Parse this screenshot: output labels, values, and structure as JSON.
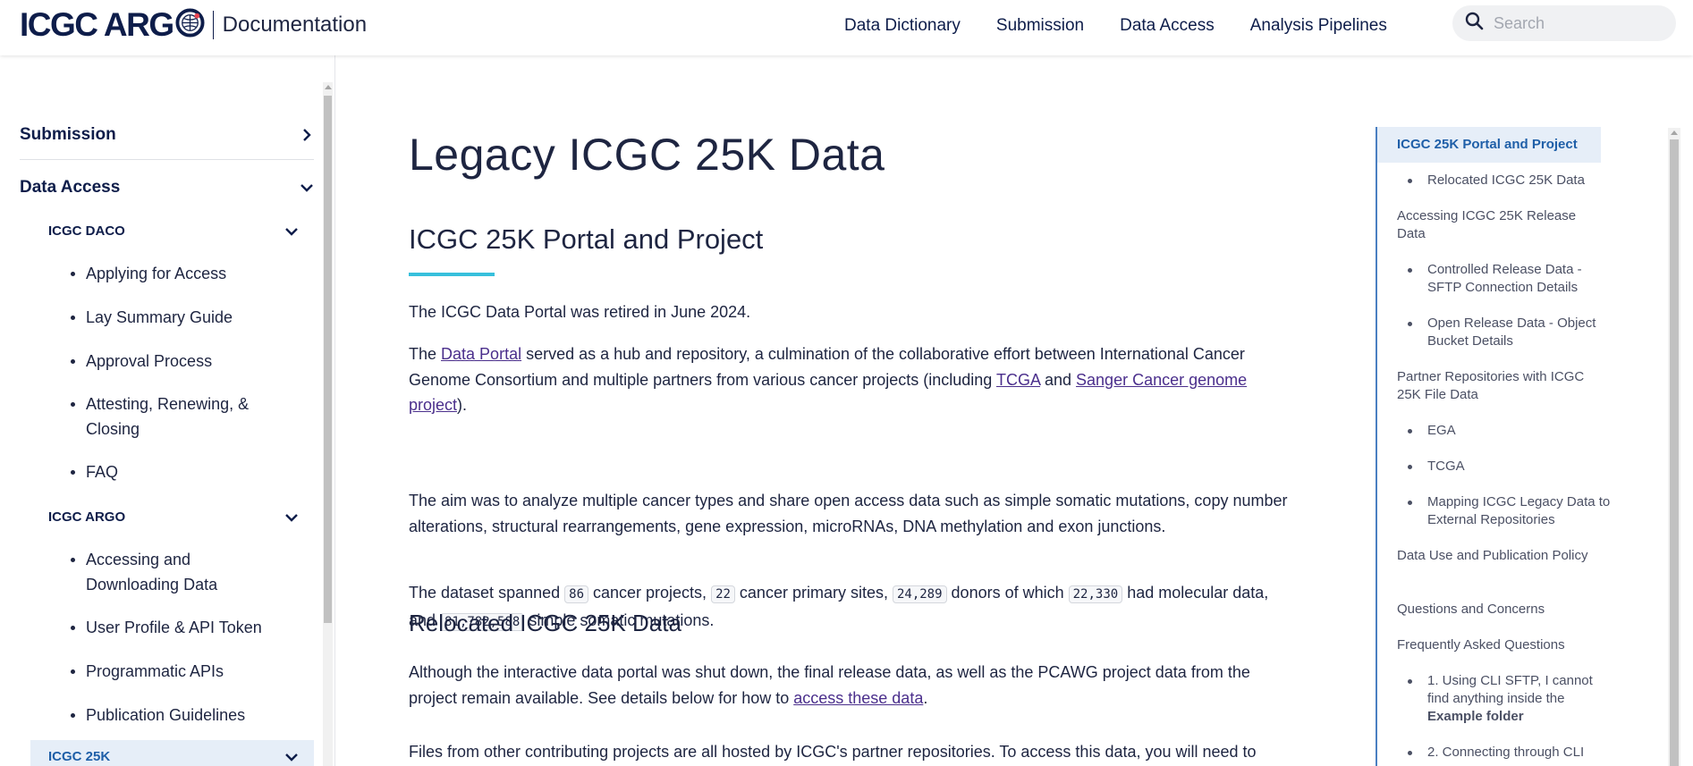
{
  "header": {
    "logo_text": "ICGC ARG",
    "subtitle": "Documentation",
    "nav": [
      "Data Dictionary",
      "Submission",
      "Data Access",
      "Analysis Pipelines"
    ],
    "search_placeholder": "Search"
  },
  "sidebar": {
    "top_items": [
      "Submission",
      "Data Access"
    ],
    "sections": [
      "ICGC DACO",
      "ICGC ARGO",
      "ICGC 25K"
    ],
    "daco_links": [
      "Applying for Access",
      "Lay Summary Guide",
      "Approval Process",
      "Attesting, Renewing, & Closing",
      "FAQ"
    ],
    "argo_links": [
      "Accessing and Downloading Data",
      "User Profile & API Token",
      "Programmatic APIs",
      "Publication Guidelines"
    ]
  },
  "main": {
    "title": "Legacy ICGC 25K Data",
    "section_title": "ICGC 25K Portal and Project",
    "p1": "The ICGC Data Portal was retired in June 2024.",
    "p2": {
      "a": "The ",
      "link1": "Data Portal",
      "b": " served as a hub and repository, a culmination of the collaborative effort between International Cancer Genome Consortium and multiple partners from various cancer projects (including ",
      "link2": "TCGA",
      "c": " and ",
      "link3": "Sanger Cancer genome project",
      "d": ")."
    },
    "p3": "The aim was to analyze multiple cancer types and share open access data such as simple somatic mutations, copy number alterations, structural rearrangements, gene expression, microRNAs, DNA methylation and exon junctions.",
    "p4": {
      "a": "The dataset spanned ",
      "n1": "86",
      "b": " cancer projects, ",
      "n2": "22",
      "c": " cancer primary sites, ",
      "n3": "24,289",
      "d": " donors of which ",
      "n4": "22,330",
      "e": " had molecular data, and ",
      "n5": "81,782,588",
      "f": " simple somatic mutations."
    },
    "subsection_title": "Relocated ICGC 25K Data",
    "p5": {
      "a": "Although the interactive data portal was shut down, the final release data, as well as the PCAWG project data from the project remain available. See details below for how to ",
      "link": "access these data",
      "b": "."
    },
    "p6": "Files from other contributing projects are all hosted by ICGC's partner repositories. To access this data, you will need to identify which repository hosts the data you are looking for and then request the data through their"
  },
  "toc": {
    "items": [
      {
        "level": 1,
        "text": "ICGC 25K Portal and Project",
        "current": true
      },
      {
        "level": 2,
        "text": "Relocated ICGC 25K Data"
      },
      {
        "level": 1,
        "text": "Accessing ICGC 25K Release Data"
      },
      {
        "level": 2,
        "text": "Controlled Release Data - SFTP Connection Details"
      },
      {
        "level": 2,
        "text": "Open Release Data - Object Bucket Details"
      },
      {
        "level": 1,
        "text": "Partner Repositories with ICGC 25K File Data"
      },
      {
        "level": 2,
        "text": "EGA"
      },
      {
        "level": 2,
        "text": "TCGA"
      },
      {
        "level": 2,
        "text": "Mapping ICGC Legacy Data to External Repositories"
      },
      {
        "level": 1,
        "text": "Data Use and Publication Policy"
      },
      {
        "level": 1,
        "text": "Questions and Concerns"
      },
      {
        "level": 1,
        "text": "Frequently Asked Questions"
      },
      {
        "level": 2,
        "text_a": "1. Using CLI SFTP, I cannot find anything inside the ",
        "text_b": "Example folder"
      },
      {
        "level": 2,
        "text": "2. Connecting through CLI"
      }
    ]
  },
  "colors": {
    "navy": "#0e1d4a",
    "accent_bar": "#37c0dc",
    "link": "#4b2f8c",
    "active_bg": "#e6eef8",
    "toc_current": "#1f5fa8"
  },
  "icons": [
    "globe-logo-icon",
    "search-icon",
    "chevron-right-icon",
    "chevron-down-icon"
  ]
}
